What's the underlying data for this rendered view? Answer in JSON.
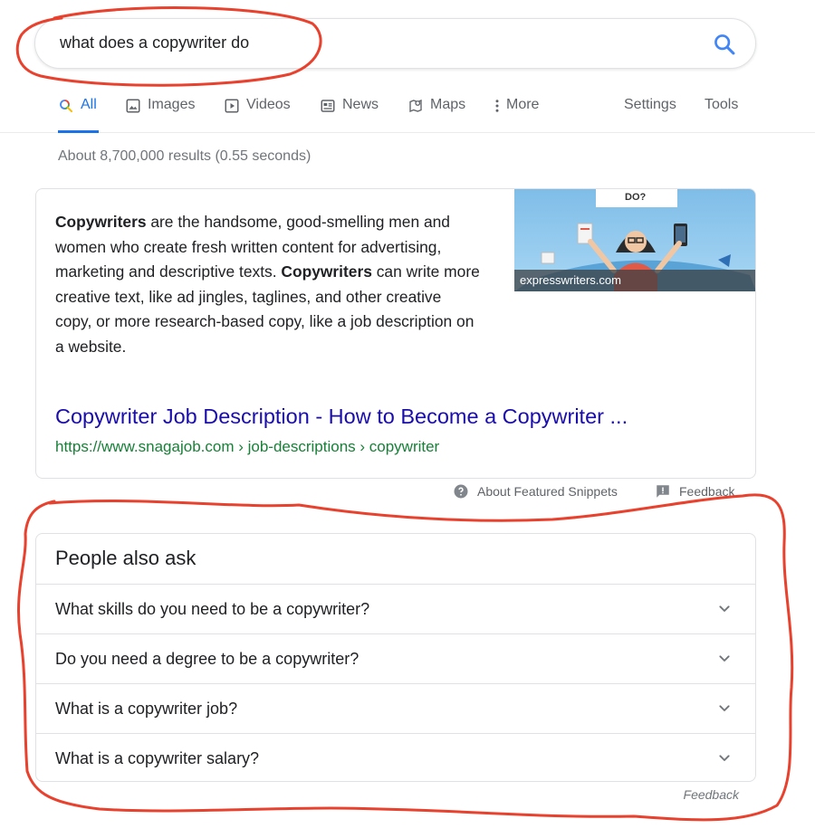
{
  "search": {
    "query": "what does a copywriter do",
    "icon": "search-icon"
  },
  "tabs": [
    {
      "label": "All",
      "icon": "search-icon",
      "active": true
    },
    {
      "label": "Images",
      "icon": "image-icon"
    },
    {
      "label": "Videos",
      "icon": "play-icon"
    },
    {
      "label": "News",
      "icon": "newspaper-icon"
    },
    {
      "label": "Maps",
      "icon": "map-pin-icon"
    },
    {
      "label": "More",
      "icon": "more-vert-icon"
    },
    {
      "label": "Settings"
    },
    {
      "label": "Tools"
    }
  ],
  "stats": "About 8,700,000 results (0.55 seconds)",
  "snippet": {
    "keyword": "Copywriters",
    "text_1": " are the handsome, good-smelling men and women who create fresh written content for advertising, marketing and descriptive texts. ",
    "text_2": " can write more creative text, like ad jingles, taglines, and other creative copy, or more research-based copy, like a job description on a website.",
    "image_caption": "expresswriters.com",
    "image_banner_text": "DO?",
    "link_title": "Copywriter Job Description - How to Become a Copywriter ...",
    "url": "https://www.snagajob.com › job-descriptions › copywriter"
  },
  "snippet_footer": {
    "about": "About Featured Snippets",
    "feedback": "Feedback"
  },
  "people_also_ask": {
    "title": "People also ask",
    "questions": [
      "What skills do you need to be a copywriter?",
      "Do you need a degree to be a copywriter?",
      "What is a copywriter job?",
      "What is a copywriter salary?"
    ],
    "feedback": "Feedback"
  },
  "colors": {
    "accent": "#1a73e8",
    "link": "#1a0dab",
    "url": "#188038",
    "annotation": "#e8412e"
  }
}
